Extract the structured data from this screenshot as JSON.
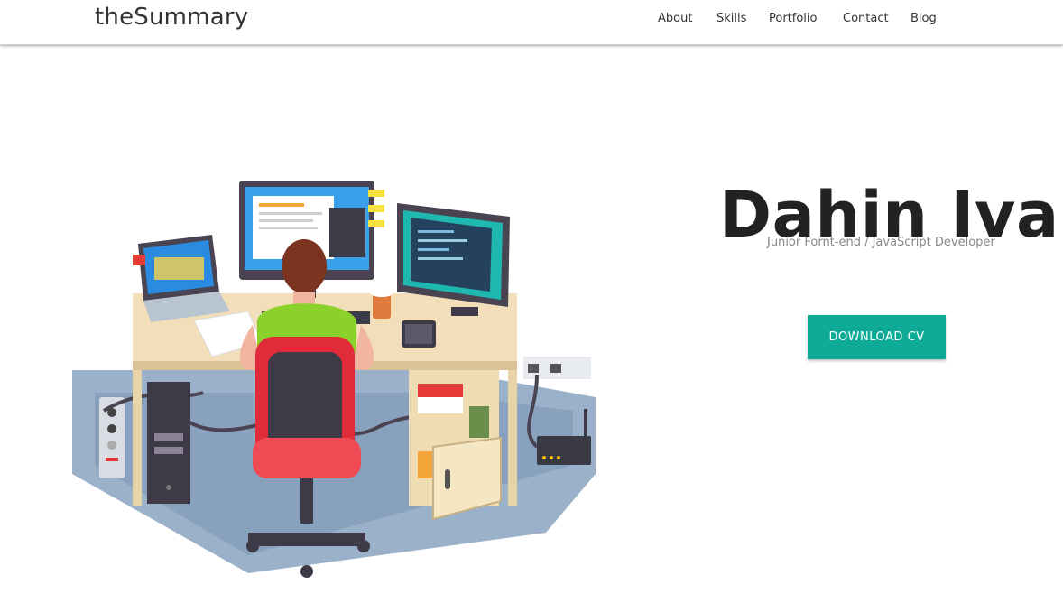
{
  "navbar": {
    "brand": "theSummary",
    "links": [
      "About",
      "Skills",
      "Portfolio",
      "Contact",
      "Blog"
    ]
  },
  "hero": {
    "name": "Dahin Ivan",
    "tagline": "Junior Fornt-end / JavaScript Developer",
    "cta_label": "DOWNLOAD CV",
    "illustration_icon": "developer-at-desk-illustration"
  },
  "colors": {
    "accent": "#0eab96",
    "text_dark": "#222222",
    "text_muted": "#888888"
  }
}
